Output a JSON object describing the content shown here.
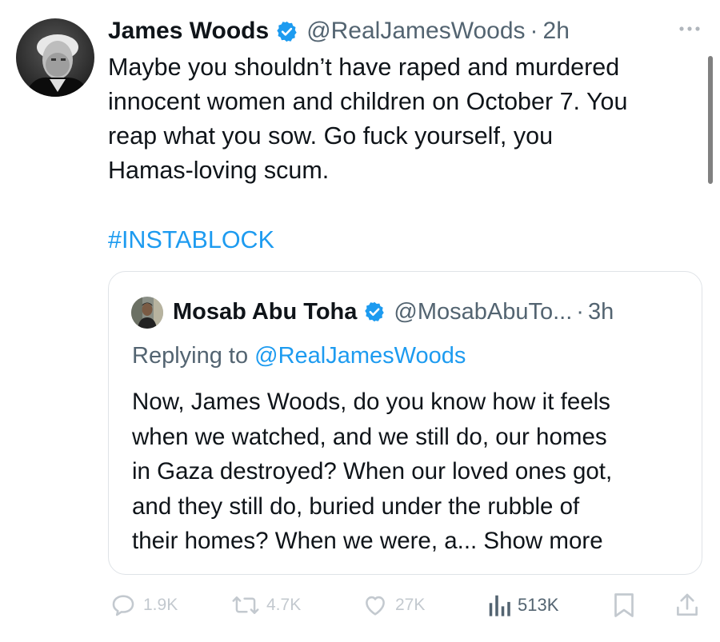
{
  "tweet": {
    "author_name": "James Woods",
    "handle": "@RealJamesWoods",
    "separator": "·",
    "time": "2h",
    "text_lines": [
      "Maybe you shouldn’t have raped and murdered",
      "innocent women and children on October 7. You",
      "reap what you sow.  Go fuck yourself, you",
      "Hamas-loving scum."
    ],
    "hashtag": "#INSTABLOCK"
  },
  "quoted_tweet": {
    "author_name": "Mosab Abu Toha",
    "handle": "@MosabAbuTo...",
    "separator": "·",
    "time": "3h",
    "replying_prefix": "Replying to",
    "replying_to": "@RealJamesWoods",
    "text_lines": [
      "Now, James Woods, do you know how it feels",
      "when we watched, and we still do, our homes",
      "in Gaza destroyed? When our loved ones got,",
      "and they still do, buried under the rubble of",
      "their homes? When we were, a... Show more"
    ]
  },
  "actions": {
    "replies": "1.9K",
    "reposts": "4.7K",
    "likes": "27K",
    "views": "513K"
  },
  "icons": {
    "verified": "verified-badge-icon",
    "more": "more-horizontal-icon",
    "reply": "reply-icon",
    "repost": "repost-icon",
    "like": "heart-icon",
    "views": "views-chart-icon",
    "bookmark": "bookmark-icon",
    "share": "share-icon"
  },
  "colors": {
    "link": "#1d9bf0",
    "secondary_text": "#536471",
    "primary_text": "#0f1419",
    "faded_action": "#c3c9cf"
  }
}
